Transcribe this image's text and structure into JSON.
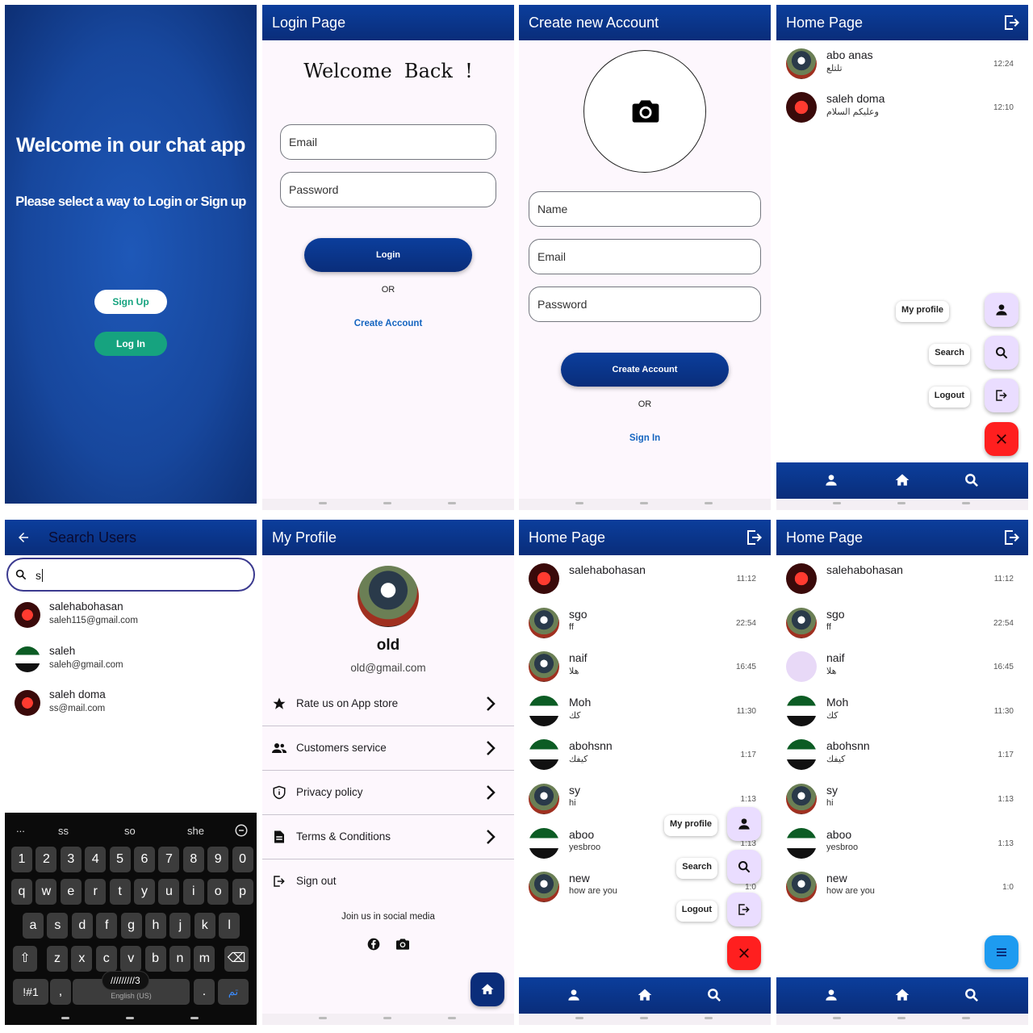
{
  "welcome": {
    "title": "Welcome in our chat app",
    "subtitle": "Please select a way to Login or Sign up",
    "signup_label": "Sign Up",
    "login_label": "Log In"
  },
  "login": {
    "appbar_title": "Login Page",
    "heading": "Welcome  Back  !",
    "email_placeholder": "Email",
    "password_placeholder": "Password",
    "login_button": "Login",
    "or_text": "OR",
    "create_account_link": "Create Account"
  },
  "register": {
    "appbar_title": "Create new Account",
    "name_placeholder": "Name",
    "email_placeholder": "Email",
    "password_placeholder": "Password",
    "create_button": "Create Account",
    "or_text": "OR",
    "sign_in_link": "Sign In"
  },
  "home1": {
    "appbar_title": "Home Page",
    "chats": [
      {
        "name": "abo anas",
        "message": "تلتلع",
        "time": "12:24"
      },
      {
        "name": "saleh doma",
        "message": "وعليكم السلام",
        "time": "12:10"
      }
    ],
    "fab_menu": {
      "profile_label": "My profile",
      "search_label": "Search",
      "logout_label": "Logout"
    }
  },
  "search": {
    "appbar_title": "Search Users",
    "query": "s",
    "results": [
      {
        "name": "salehabohasan",
        "email": "saleh115@gmail.com"
      },
      {
        "name": "saleh",
        "email": "saleh@gmail.com"
      },
      {
        "name": "saleh doma",
        "email": "ss@mail.com"
      }
    ],
    "keyboard": {
      "suggestions": [
        "...",
        "ss",
        "so",
        "she"
      ],
      "row_numbers": [
        "1",
        "2",
        "3",
        "4",
        "5",
        "6",
        "7",
        "8",
        "9",
        "0"
      ],
      "row1": [
        "q",
        "w",
        "e",
        "r",
        "t",
        "y",
        "u",
        "i",
        "o",
        "p"
      ],
      "row2": [
        "a",
        "s",
        "d",
        "f",
        "g",
        "h",
        "j",
        "k",
        "l"
      ],
      "row3": [
        "z",
        "x",
        "c",
        "v",
        "b",
        "n",
        "m"
      ],
      "symbols_key": "!#1",
      "comma_key": ",",
      "period_key": ".",
      "enter_key": "تم",
      "space_label": "English (US)",
      "toast": "/////////3"
    }
  },
  "profile": {
    "appbar_title": "My Profile",
    "username": "old",
    "email": "old@gmail.com",
    "items": [
      {
        "label": "Rate us on App store"
      },
      {
        "label": "Customers service"
      },
      {
        "label": "Privacy policy"
      },
      {
        "label": "Terms & Conditions"
      }
    ],
    "sign_out": "Sign out",
    "social_heading": "Join us in social media"
  },
  "home2": {
    "appbar_title": "Home Page",
    "chats": [
      {
        "name": "salehabohasan",
        "message": "",
        "time": "11:12"
      },
      {
        "name": "sgo",
        "message": "ff",
        "time": "22:54"
      },
      {
        "name": "naif",
        "message": "هلا",
        "time": "16:45"
      },
      {
        "name": "Moh",
        "message": "كك",
        "time": "11:30"
      },
      {
        "name": "abohsnn",
        "message": "كيفك",
        "time": "1:17"
      },
      {
        "name": "sy",
        "message": "hi",
        "time": "1:13"
      },
      {
        "name": "aboo",
        "message": "yesbroo",
        "time": "1:13"
      },
      {
        "name": "new",
        "message": "how are you",
        "time": "1:0"
      }
    ],
    "fab_menu": {
      "profile_label": "My profile",
      "search_label": "Search",
      "logout_label": "Logout"
    }
  },
  "home3": {
    "appbar_title": "Home Page",
    "chats": [
      {
        "name": "salehabohasan",
        "message": "",
        "time": "11:12"
      },
      {
        "name": "sgo",
        "message": "ff",
        "time": "22:54"
      },
      {
        "name": "naif",
        "message": "هلا",
        "time": "16:45"
      },
      {
        "name": "Moh",
        "message": "كك",
        "time": "11:30"
      },
      {
        "name": "abohsnn",
        "message": "كيفك",
        "time": "1:17"
      },
      {
        "name": "sy",
        "message": "hi",
        "time": "1:13"
      },
      {
        "name": "aboo",
        "message": "yesbroo",
        "time": "1:13"
      },
      {
        "name": "new",
        "message": "how are you",
        "time": "1:0"
      }
    ]
  },
  "colors": {
    "primary": "#0a2d7a",
    "accent_green": "#16a37f",
    "link_blue": "#1565c0",
    "fab_purple": "#eaddff",
    "fab_red": "#ff1f1f",
    "fab_blue": "#1e9bf0"
  }
}
